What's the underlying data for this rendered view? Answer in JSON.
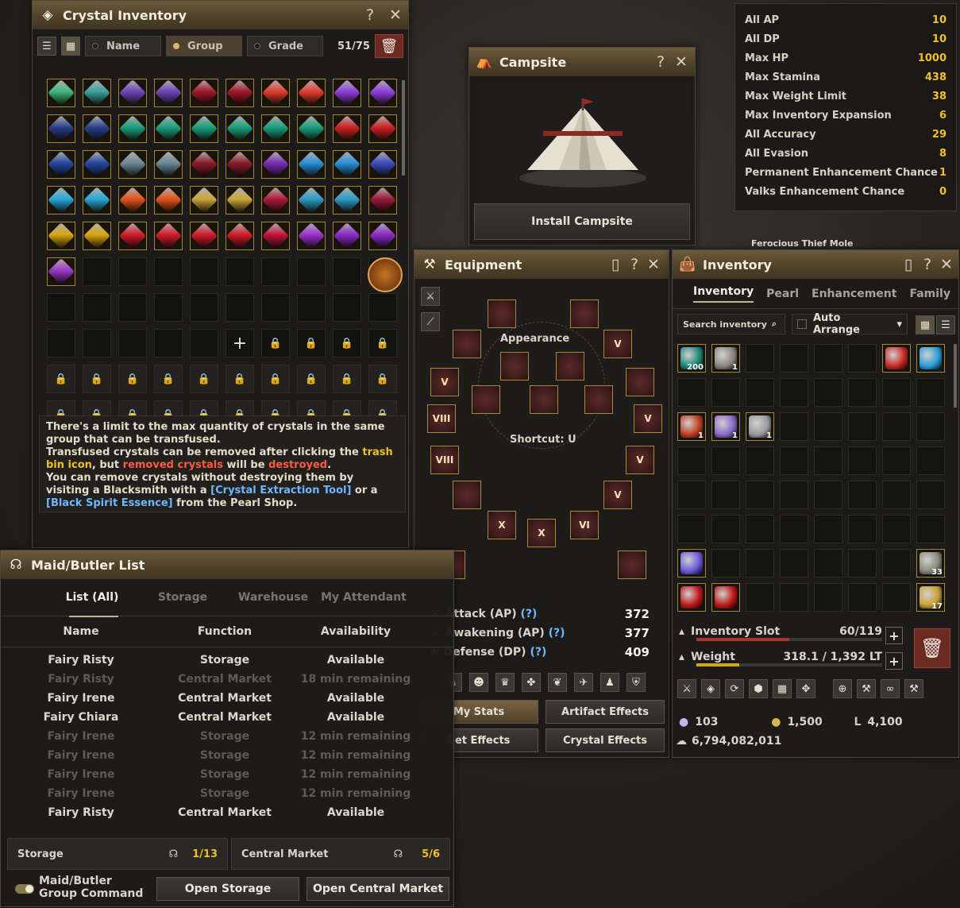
{
  "crystal": {
    "title": "Crystal Inventory",
    "help": "?",
    "close": "✕",
    "sort_name": "Name",
    "sort_group": "Group",
    "sort_grade": "Grade",
    "count": "51/75",
    "note_1": "There's a limit to the max quantity of crystals in the same group that can be transfused.",
    "note_2a": "Transfused crystals can be removed after clicking the ",
    "note_2b": "trash bin icon",
    "note_2c": ", but ",
    "note_2d": "removed crystals",
    "note_2e": " will be ",
    "note_2f": "destroyed",
    "note_2g": ".",
    "note_3a": "You can remove crystals without destroying them by visiting a Blacksmith with a ",
    "note_3b": "[Crystal Extraction Tool]",
    "note_3c": " or a ",
    "note_3d": "[Black Spirit Essence]",
    "note_3e": " from the Pearl Shop.",
    "gem_colors": [
      "#3fb87a",
      "#3aa3a0",
      "#6b44b8",
      "#6b44b8",
      "#a01826",
      "#a01826",
      "#e23b2d",
      "#e23b2d",
      "#8f3fe0",
      "#8f3fe0",
      "#2a3f8a",
      "#2a3f8a",
      "#1a9e7a",
      "#1a9e7a",
      "#1a9e7a",
      "#1a9e7a",
      "#1a9e7a",
      "#1a9e7a",
      "#c22",
      "#c22",
      "#2446a0",
      "#2446a0",
      "#6d8896",
      "#6d8896",
      "#8a1a2c",
      "#8a1a2c",
      "#7a2cb6",
      "#2a8fd8",
      "#2a8fd8",
      "#3a4cc0",
      "#2aa8d8",
      "#2aa8d8",
      "#e2541a",
      "#e2541a",
      "#c9a83a",
      "#c9a83a",
      "#b01c3a",
      "#2a9ec4",
      "#2a9ec4",
      "#9a1a3a",
      "#d9a611",
      "#d9a611",
      "#d11a2a",
      "#d11a2a",
      "#d11a2a",
      "#d11a2a",
      "#c4143a",
      "#a030d0",
      "#8a2ac8",
      "#8a2ac8",
      "#9a38c8"
    ]
  },
  "campsite": {
    "title": "Campsite",
    "help": "?",
    "close": "✕",
    "install": "Install Campsite"
  },
  "stats": [
    {
      "name": "All AP",
      "value": "10"
    },
    {
      "name": "All DP",
      "value": "10"
    },
    {
      "name": "Max HP",
      "value": "1000"
    },
    {
      "name": "Max Stamina",
      "value": "438"
    },
    {
      "name": "Max Weight Limit",
      "value": "38"
    },
    {
      "name": "Max Inventory Expansion",
      "value": "6"
    },
    {
      "name": "All Accuracy",
      "value": "29"
    },
    {
      "name": "All Evasion",
      "value": "8"
    },
    {
      "name": "Permanent Enhancement Chance",
      "value": "1"
    },
    {
      "name": "Valks Enhancement Chance",
      "value": "0"
    }
  ],
  "world_label": "Ferocious Thief Mole",
  "equipment": {
    "title": "Equipment",
    "help": "?",
    "close": "✕",
    "appearance": "Appearance",
    "shortcut": "Shortcut: U",
    "attack_label": "Attack (AP)",
    "attack_q": "(?)",
    "attack_val": "372",
    "awk_label": "Awakening (AP)",
    "awk_q": "(?)",
    "awk_val": "377",
    "def_label": "Defense (DP)",
    "def_q": "(?)",
    "def_val": "409",
    "btn_my_stats": "My Stats",
    "btn_artifact": "Artifact Effects",
    "btn_set": "Set Effects",
    "btn_crystal": "Crystal Effects",
    "gear_marks": [
      "V",
      "VIII",
      "V",
      "VIII",
      "V",
      "X",
      "X",
      "V",
      "VI",
      "V"
    ]
  },
  "inventory": {
    "title": "Inventory",
    "help": "?",
    "close": "✕",
    "tab_inventory": "Inventory",
    "tab_pearl": "Pearl",
    "tab_enhancement": "Enhancement",
    "tab_family": "Family",
    "search_placeholder": "Search inventory",
    "arrange": "Auto Arrange",
    "slot_label": "Inventory Slot",
    "slot_val": "60/119",
    "slot_fill_pct": 50,
    "weight_label": "Weight",
    "weight_val": "318.1 / 1,392 LT",
    "weight_fill_pct": 23,
    "pearls": "103",
    "gold": "1,500",
    "loyalty": "4,100",
    "silver": "6,794,082,011",
    "items": [
      {
        "c": "#1d8a7a",
        "q": "200"
      },
      {
        "c": "#8a8680",
        "q": "1"
      },
      null,
      null,
      null,
      null,
      {
        "c": "#c82a22",
        "q": ""
      },
      {
        "c": "#2a9ed8",
        "q": ""
      },
      null,
      null,
      null,
      null,
      null,
      null,
      null,
      null,
      {
        "c": "#c04020",
        "q": "1"
      },
      {
        "c": "#8a6ac8",
        "q": "1"
      },
      {
        "c": "#9a9a9a",
        "q": "1"
      },
      null,
      null,
      null,
      null,
      null,
      null,
      null,
      null,
      null,
      null,
      null,
      null,
      null,
      null,
      null,
      null,
      null,
      null,
      null,
      null,
      null,
      null,
      null,
      null,
      null,
      null,
      null,
      null,
      null,
      {
        "c": "#6a5ad8",
        "q": ""
      },
      null,
      null,
      null,
      null,
      null,
      null,
      {
        "c": "#8a8a7a",
        "q": "33"
      },
      {
        "c": "#c01818",
        "q": ""
      },
      {
        "c": "#c01818",
        "q": ""
      },
      null,
      null,
      null,
      null,
      null,
      {
        "c": "#c9a030",
        "q": "17"
      }
    ]
  },
  "maid": {
    "title": "Maid/Butler List",
    "tab_list": "List (All)",
    "tab_storage": "Storage",
    "tab_warehouse": "Warehouse",
    "tab_attendant": "My Attendant",
    "h_name": "Name",
    "h_function": "Function",
    "h_avail": "Availability",
    "rows": [
      {
        "name": "Fairy Risty",
        "fn": "Storage",
        "avail": "Available",
        "dim": false
      },
      {
        "name": "Fairy Risty",
        "fn": "Central Market",
        "avail": "18 min remaining",
        "dim": true
      },
      {
        "name": "Fairy Irene",
        "fn": "Central Market",
        "avail": "Available",
        "dim": false
      },
      {
        "name": "Fairy Chiara",
        "fn": "Central Market",
        "avail": "Available",
        "dim": false
      },
      {
        "name": "Fairy Irene",
        "fn": "Storage",
        "avail": "12 min remaining",
        "dim": true
      },
      {
        "name": "Fairy Irene",
        "fn": "Storage",
        "avail": "12 min remaining",
        "dim": true
      },
      {
        "name": "Fairy Irene",
        "fn": "Storage",
        "avail": "12 min remaining",
        "dim": true
      },
      {
        "name": "Fairy Irene",
        "fn": "Storage",
        "avail": "12 min remaining",
        "dim": true
      },
      {
        "name": "Fairy Risty",
        "fn": "Central Market",
        "avail": "Available",
        "dim": false
      }
    ],
    "storage_label": "Storage",
    "storage_val": "1/13",
    "market_label": "Central Market",
    "market_val": "5/6",
    "group_cmd": "Maid/Butler Group Command",
    "open_storage": "Open Storage",
    "open_market": "Open Central Market"
  }
}
